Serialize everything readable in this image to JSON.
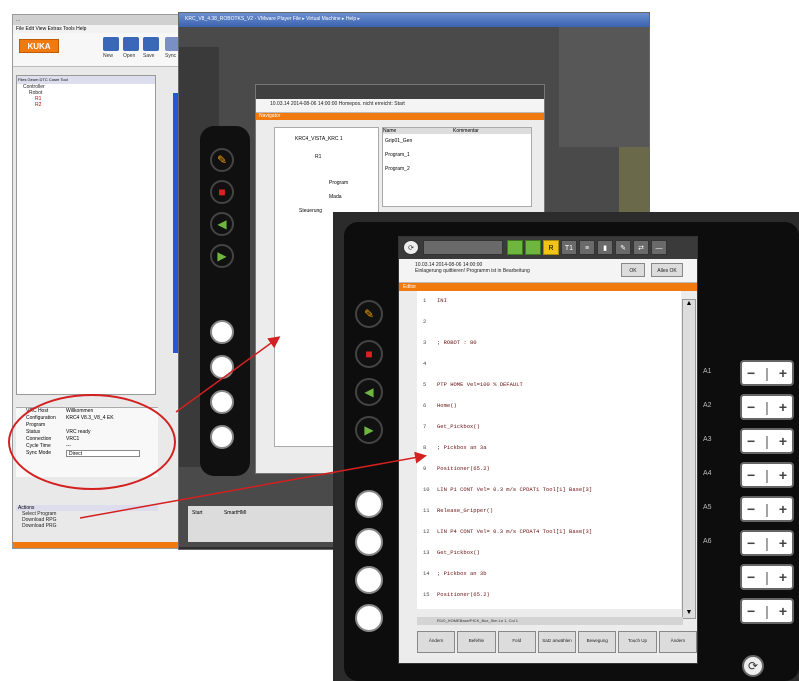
{
  "workvisual": {
    "title": "...",
    "menu": "File  Edit  View  Extras  Tools  Help",
    "logo": "KUKA",
    "toolbar": [
      "New",
      "Open",
      "Save",
      "Sync"
    ],
    "tree_tabs": "Files  Geom  DTC  Cosm  Tool",
    "tree_items": [
      "Controller",
      "Robot",
      "R1",
      "R2"
    ],
    "props": [
      {
        "k": "VRC Host",
        "v": "Willkommen"
      },
      {
        "k": "Configuration",
        "v": "KRC4 V8.3_V8_4 EK"
      },
      {
        "k": "Program",
        "v": ""
      },
      {
        "k": "Status",
        "v": "VRC ready"
      },
      {
        "k": "Connection",
        "v": "VRC1"
      },
      {
        "k": "Cycle Time",
        "v": "---"
      },
      {
        "k": "Sync Mode",
        "v": "Direct"
      }
    ],
    "actions_title": "Actions",
    "actions": [
      "Select Program",
      "Download RPG",
      "Download PRG"
    ]
  },
  "player": {
    "title": "KRC_V8_4.38_ROBOTKS_V2 - VMware Player   File  ▸  Virtual Machine  ▸  Help  ▸",
    "taskbar": [
      "Start",
      "SmartHMI",
      "KUKA"
    ]
  },
  "small_hmi": {
    "msg_time": "10.03.14 2014-08-06 14:00:00",
    "msg_text": "Homepos. nicht erreicht: Start",
    "header": "Navigator",
    "folders": [
      "R1",
      "KRC4_VISTA_KRC 1",
      "Program",
      "Mada",
      "Steuerung"
    ],
    "cols": [
      "Name",
      "Kommentar"
    ],
    "files": [
      "Grip01_Gen",
      "Program_1",
      "Program_2"
    ]
  },
  "big_hmi": {
    "msg_time": "10.03.14 2014-08-06 14:00:00",
    "msg_text": "Einlagerung quittieren! Programm ist in Bearbeitung",
    "ok": "OK",
    "all_ok": "Alles OK",
    "header": "Editor",
    "code": [
      {
        "n": "1",
        "t": "INI"
      },
      {
        "n": "2",
        "t": ""
      },
      {
        "n": "3",
        "t": "; ROBOT : 80"
      },
      {
        "n": "4",
        "t": ""
      },
      {
        "n": "5",
        "t": "PTP HOME Vel=100 % DEFAULT"
      },
      {
        "n": "6",
        "t": "Home()"
      },
      {
        "n": "7",
        "t": "Get_Pickbox()"
      },
      {
        "n": "8",
        "t": "; Pickbox an 3a"
      },
      {
        "n": "9",
        "t": "Positioner(65.2)"
      },
      {
        "n": "10",
        "t": "LIN P1 CONT Vel= 0.3 m/s CPDAT1 Tool[1] Base[3]"
      },
      {
        "n": "11",
        "t": "Release_Gripper()"
      },
      {
        "n": "12",
        "t": "LIN P4 CONT Vel= 0.3 m/s CPDAT4 Tool[1] Base[3]"
      },
      {
        "n": "13",
        "t": "Get_Pickbox()"
      },
      {
        "n": "14",
        "t": "; Pickbox an 3b"
      },
      {
        "n": "15",
        "t": "Positioner(65.2)"
      }
    ],
    "status": "R1/0_HOMEBase/PICK_Box_Sim    Ln 1, Col 1",
    "softkeys": [
      "Ändern",
      "Befehle",
      "Fold",
      "Satz anwählen",
      "Bewegung",
      "Touch Up",
      "Ändern"
    ],
    "axis_labels": [
      "A1",
      "A2",
      "A3",
      "A4",
      "A5",
      "A6"
    ],
    "jog_minus": "−",
    "jog_plus": "+"
  }
}
